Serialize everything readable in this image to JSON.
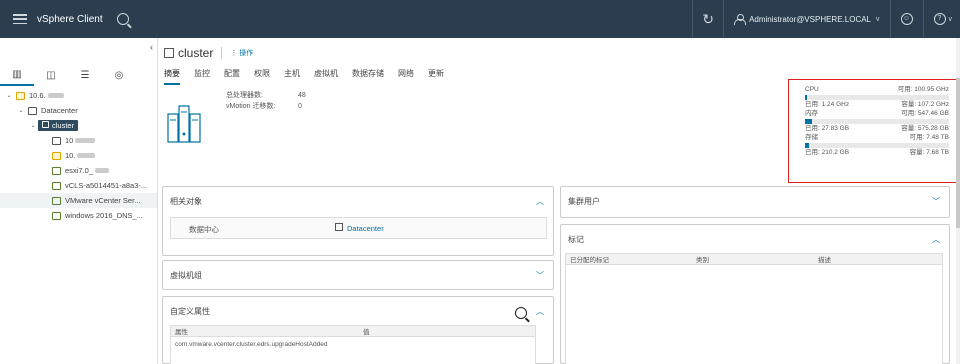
{
  "header": {
    "app_title": "vSphere Client",
    "user": "Administrator@VSPHERE.LOCAL",
    "user_caret": "v",
    "help_caret": "v",
    "help_mark": "?"
  },
  "left": {
    "tabs": [
      "hosts-clusters",
      "vms-templates",
      "storage",
      "networking"
    ],
    "tree": [
      {
        "label": "10.6.",
        "level": 0,
        "type": "vcenter"
      },
      {
        "label": "Datacenter",
        "level": 1,
        "type": "datacenter"
      },
      {
        "label": "cluster",
        "level": 2,
        "type": "cluster",
        "selected": true
      },
      {
        "label": "10",
        "level": 3,
        "type": "host-ok"
      },
      {
        "label": "10.",
        "level": 3,
        "type": "host-warn"
      },
      {
        "label": "esxi7.0_",
        "level": 3,
        "type": "vm"
      },
      {
        "label": "vCLS-a5014451-a8a3-...",
        "level": 3,
        "type": "vm"
      },
      {
        "label": "VMware vCenter Ser...",
        "level": 3,
        "type": "vm"
      },
      {
        "label": "windows 2016_DNS_...",
        "level": 3,
        "type": "vm"
      }
    ]
  },
  "object": {
    "title": "cluster",
    "actions_label": "操作",
    "tabs": [
      "摘要",
      "监控",
      "配置",
      "权限",
      "主机",
      "虚拟机",
      "数据存储",
      "网络",
      "更新"
    ],
    "info": [
      {
        "key": "总处理器数:",
        "value": "48"
      },
      {
        "key": "vMotion 迁移数:",
        "value": "0"
      }
    ]
  },
  "resources": {
    "cpu": {
      "label": "CPU",
      "free": "可用: 100.95 GHz",
      "used": "已用: 1.24 GHz",
      "capacity": "容量: 107.2 GHz",
      "percent": 1.2
    },
    "memory": {
      "label": "内存",
      "free": "可用: 547.46 GB",
      "used": "已用: 27.83 GB",
      "capacity": "容量: 575.28 GB",
      "percent": 4.8
    },
    "storage": {
      "label": "存储",
      "free": "可用: 7.48 TB",
      "used": "已用: 210.2 GB",
      "capacity": "容量: 7.68 TB",
      "percent": 2.7
    }
  },
  "panels": {
    "related": {
      "title": "相关对象",
      "row_key": "数据中心",
      "row_value": "Datacenter"
    },
    "vsan": {
      "title": "虚拟机组"
    },
    "custom": {
      "title": "自定义属性",
      "col1": "属性",
      "col2": "值",
      "row1": "com.vmware.vcenter.cluster.edrs.upgradeHostAdded"
    },
    "users": {
      "title": "集群用户"
    },
    "tags": {
      "title": "标记",
      "col1": "已分配的标记",
      "col2": "类别",
      "col3": "描述"
    }
  }
}
